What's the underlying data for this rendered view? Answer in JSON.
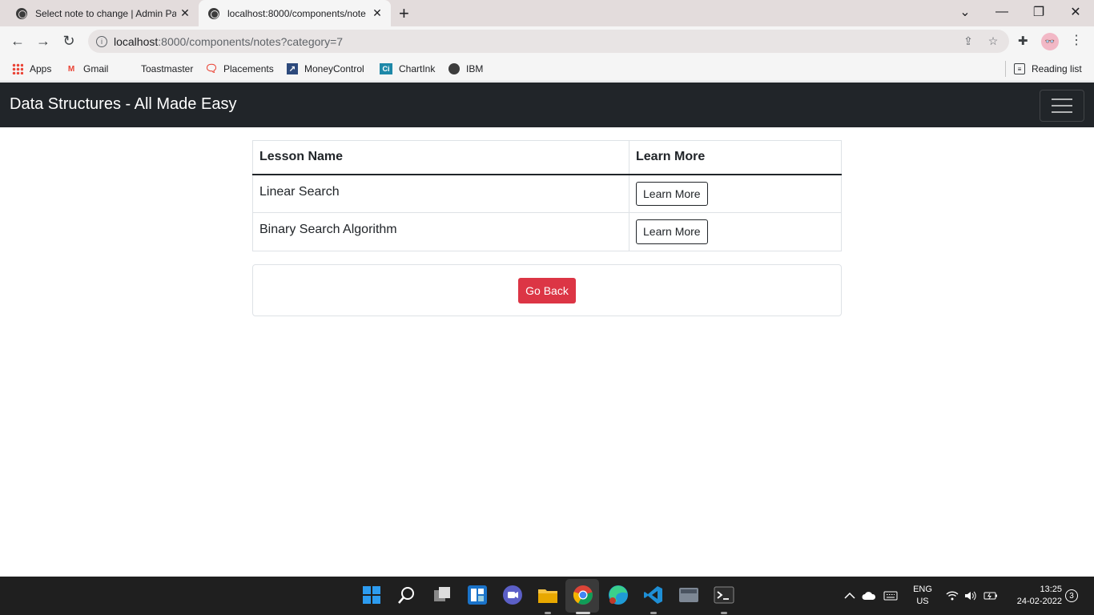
{
  "browser": {
    "tabs": [
      {
        "title": "Select note to change | Admin Pa",
        "active": false
      },
      {
        "title": "localhost:8000/components/note",
        "active": true
      }
    ],
    "url_host": "localhost",
    "url_rest": ":8000/components/notes?category=7",
    "bookmarks": [
      {
        "label": "Apps",
        "icon": "apps-grid-icon"
      },
      {
        "label": "Gmail",
        "icon": "gmail-icon"
      },
      {
        "label": "Toastmaster",
        "icon": "toastmaster-icon"
      },
      {
        "label": "Placements",
        "icon": "chat-bubble-icon"
      },
      {
        "label": "MoneyControl",
        "icon": "moneycontrol-icon"
      },
      {
        "label": "ChartInk",
        "icon": "chartink-icon"
      },
      {
        "label": "IBM",
        "icon": "globe-icon"
      }
    ],
    "reading_list": "Reading list",
    "profile_glyph": "👓"
  },
  "navbar": {
    "brand": "Data Structures - All Made Easy"
  },
  "table": {
    "headers": [
      "Lesson Name",
      "Learn More"
    ],
    "rows": [
      {
        "name": "Linear Search",
        "button": "Learn More"
      },
      {
        "name": "Binary Search Algorithm",
        "button": "Learn More"
      }
    ]
  },
  "go_back": "Go Back",
  "colors": {
    "navbar_bg": "#212529",
    "danger": "#dc3545"
  },
  "taskbar": {
    "lang_1": "ENG",
    "lang_2": "US",
    "time": "13:25",
    "date": "24-02-2022",
    "notifications": "3"
  }
}
